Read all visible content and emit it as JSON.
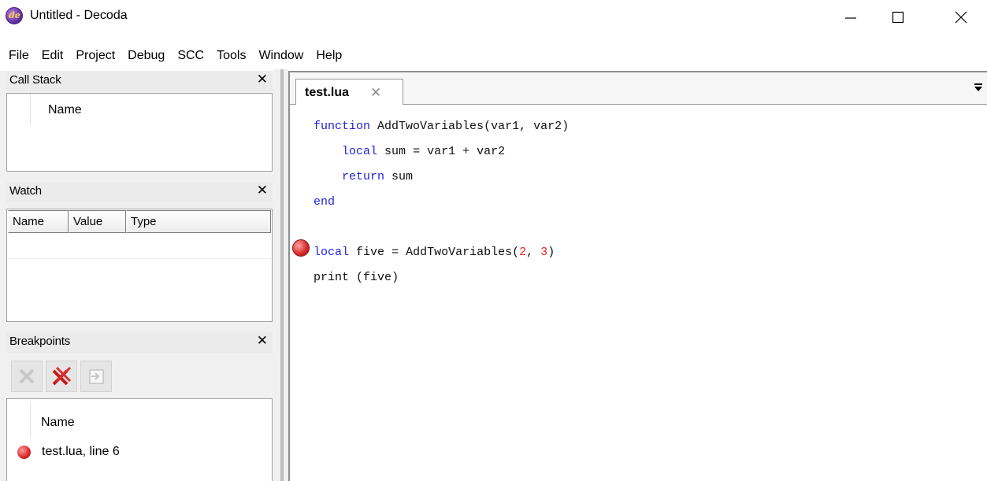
{
  "window": {
    "title": "Untitled - Decoda",
    "app_icon_text": "de",
    "controls": {
      "minimize": "minimize",
      "maximize": "maximize",
      "close": "close"
    }
  },
  "menu": [
    "File",
    "Edit",
    "Project",
    "Debug",
    "SCC",
    "Tools",
    "Window",
    "Help"
  ],
  "call_stack": {
    "title": "Call Stack",
    "close": "✕",
    "column_name": "Name"
  },
  "watch": {
    "title": "Watch",
    "close": "✕",
    "columns": [
      "Name",
      "Value",
      "Type"
    ]
  },
  "breakpoints": {
    "title": "Breakpoints",
    "close": "✕",
    "toolbar": [
      "remove-breakpoint",
      "remove-all-breakpoints",
      "goto-breakpoint"
    ],
    "column_name": "Name",
    "items": [
      {
        "label": "test.lua, line 6"
      }
    ]
  },
  "editor": {
    "tab_label": "test.lua",
    "tab_close": "✕",
    "breakpoint_line": 6,
    "lines": [
      "function AddTwoVariables(var1, var2)",
      "    local sum = var1 + var2",
      "    return sum",
      "end",
      "",
      "local five = AddTwoVariables(2, 3)",
      "print (five)"
    ]
  },
  "colors": {
    "keyword": "#1f1fe0",
    "number": "#ee2222",
    "breakpoint": "#d11f1f"
  }
}
